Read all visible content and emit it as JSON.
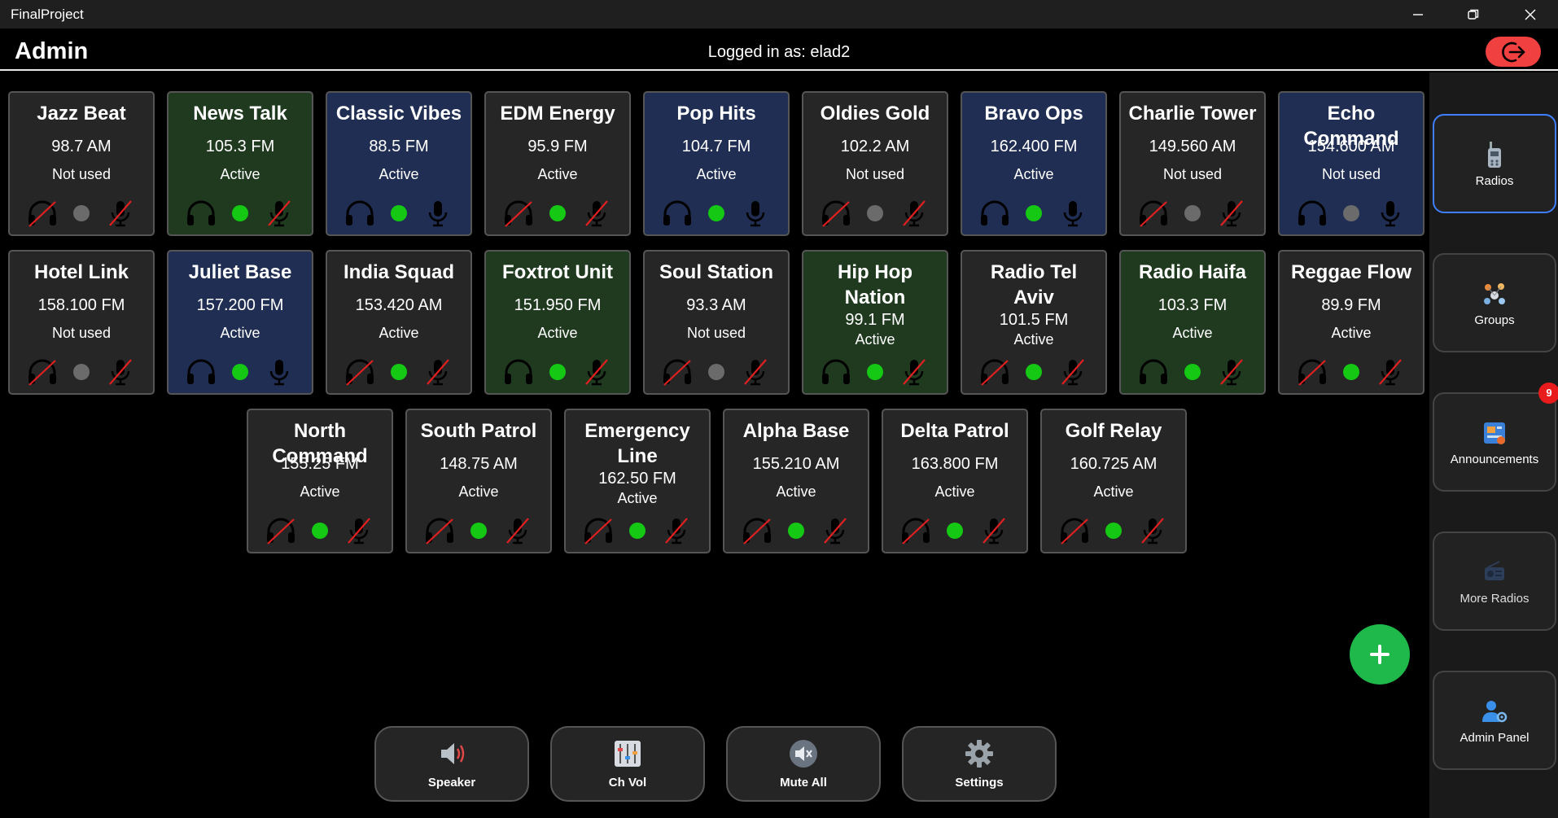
{
  "window": {
    "title": "FinalProject"
  },
  "header": {
    "title": "Admin",
    "logged_in": "Logged in as: elad2"
  },
  "radios": [
    {
      "name": "Jazz Beat",
      "freq": "98.7 AM",
      "status": "Not used",
      "theme": "gray",
      "dot": "gray",
      "headphones": "off",
      "mic": "off"
    },
    {
      "name": "News Talk",
      "freq": "105.3 FM",
      "status": "Active",
      "theme": "green",
      "dot": "green",
      "headphones": "on",
      "mic": "off"
    },
    {
      "name": "Classic Vibes",
      "freq": "88.5 FM",
      "status": "Active",
      "theme": "blue",
      "dot": "green",
      "headphones": "on",
      "mic": "on"
    },
    {
      "name": "EDM Energy",
      "freq": "95.9 FM",
      "status": "Active",
      "theme": "gray",
      "dot": "green",
      "headphones": "off",
      "mic": "off"
    },
    {
      "name": "Pop Hits",
      "freq": "104.7 FM",
      "status": "Active",
      "theme": "blue",
      "dot": "green",
      "headphones": "on",
      "mic": "on"
    },
    {
      "name": "Oldies Gold",
      "freq": "102.2 AM",
      "status": "Not used",
      "theme": "gray",
      "dot": "gray",
      "headphones": "off",
      "mic": "off"
    },
    {
      "name": "Bravo Ops",
      "freq": "162.400 FM",
      "status": "Active",
      "theme": "blue",
      "dot": "green",
      "headphones": "on",
      "mic": "on"
    },
    {
      "name": "Charlie Tower",
      "freq": "149.560 AM",
      "status": "Not used",
      "theme": "gray",
      "dot": "gray",
      "headphones": "off",
      "mic": "off"
    },
    {
      "name": "Echo Command",
      "freq": "154.600 AM",
      "status": "Not used",
      "theme": "blue",
      "dot": "gray",
      "headphones": "on",
      "mic": "on"
    },
    {
      "name": "Hotel Link",
      "freq": "158.100 FM",
      "status": "Not used",
      "theme": "gray",
      "dot": "gray",
      "headphones": "off",
      "mic": "off"
    },
    {
      "name": "Juliet Base",
      "freq": "157.200 FM",
      "status": "Active",
      "theme": "blue",
      "dot": "green",
      "headphones": "on",
      "mic": "on"
    },
    {
      "name": "India Squad",
      "freq": "153.420 AM",
      "status": "Active",
      "theme": "gray",
      "dot": "green",
      "headphones": "off",
      "mic": "off"
    },
    {
      "name": "Foxtrot Unit",
      "freq": "151.950 FM",
      "status": "Active",
      "theme": "green",
      "dot": "green",
      "headphones": "on",
      "mic": "off"
    },
    {
      "name": "Soul Station",
      "freq": "93.3 AM",
      "status": "Not used",
      "theme": "gray",
      "dot": "gray",
      "headphones": "off",
      "mic": "off"
    },
    {
      "name": "Hip Hop Nation",
      "freq": "99.1 FM",
      "status": "Active",
      "theme": "green",
      "dot": "green",
      "headphones": "on",
      "mic": "off"
    },
    {
      "name": "Radio Tel Aviv",
      "freq": "101.5 FM",
      "status": "Active",
      "theme": "gray",
      "dot": "green",
      "headphones": "off",
      "mic": "off"
    },
    {
      "name": "Radio Haifa",
      "freq": "103.3 FM",
      "status": "Active",
      "theme": "green",
      "dot": "green",
      "headphones": "on",
      "mic": "off"
    },
    {
      "name": "Reggae Flow",
      "freq": "89.9 FM",
      "status": "Active",
      "theme": "gray",
      "dot": "green",
      "headphones": "off",
      "mic": "off"
    },
    {
      "name": "North Command",
      "freq": "155.25 FM",
      "status": "Active",
      "theme": "gray",
      "dot": "green",
      "headphones": "off",
      "mic": "off"
    },
    {
      "name": "South Patrol",
      "freq": "148.75 AM",
      "status": "Active",
      "theme": "gray",
      "dot": "green",
      "headphones": "off",
      "mic": "off"
    },
    {
      "name": "Emergency Line",
      "freq": "162.50 FM",
      "status": "Active",
      "theme": "gray",
      "dot": "green",
      "headphones": "off",
      "mic": "off"
    },
    {
      "name": "Alpha Base",
      "freq": "155.210 AM",
      "status": "Active",
      "theme": "gray",
      "dot": "green",
      "headphones": "off",
      "mic": "off"
    },
    {
      "name": "Delta Patrol",
      "freq": "163.800 FM",
      "status": "Active",
      "theme": "gray",
      "dot": "green",
      "headphones": "off",
      "mic": "off"
    },
    {
      "name": "Golf Relay",
      "freq": "160.725 AM",
      "status": "Active",
      "theme": "gray",
      "dot": "green",
      "headphones": "off",
      "mic": "off"
    }
  ],
  "sidebar": {
    "items": [
      {
        "label": "Radios",
        "icon": "walkie-talkie-icon",
        "active": true
      },
      {
        "label": "Groups",
        "icon": "groups-icon",
        "active": false
      },
      {
        "label": "Announcements",
        "icon": "announcements-icon",
        "active": false,
        "badge": "9"
      },
      {
        "label": "More Radios",
        "icon": "more-radios-icon",
        "active": false
      },
      {
        "label": "Admin Panel",
        "icon": "admin-panel-icon",
        "active": false
      }
    ]
  },
  "bottom_bar": {
    "speaker_label": "Speaker",
    "chvol_label": "Ch Vol",
    "muteall_label": "Mute All",
    "settings_label": "Settings"
  },
  "colors": {
    "green_card": "#1f3a1f",
    "blue_card": "#1f2e52",
    "gray_card": "#262626",
    "active_dot": "#14c814",
    "logout": "#f04040",
    "fab": "#1fb84a",
    "active_border": "#3f7fff"
  }
}
